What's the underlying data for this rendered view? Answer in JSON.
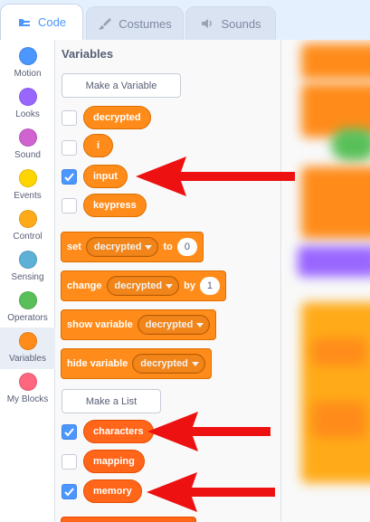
{
  "tabs": [
    {
      "label": "Code",
      "icon": "code-icon",
      "active": true
    },
    {
      "label": "Costumes",
      "icon": "paintbrush-icon",
      "active": false
    },
    {
      "label": "Sounds",
      "icon": "speaker-icon",
      "active": false
    }
  ],
  "categories": [
    {
      "label": "Motion",
      "color": "#4c97ff"
    },
    {
      "label": "Looks",
      "color": "#9966ff"
    },
    {
      "label": "Sound",
      "color": "#cf63cf"
    },
    {
      "label": "Events",
      "color": "#ffd500"
    },
    {
      "label": "Control",
      "color": "#ffab19"
    },
    {
      "label": "Sensing",
      "color": "#5cb1d6"
    },
    {
      "label": "Operators",
      "color": "#59c059"
    },
    {
      "label": "Variables",
      "color": "#ff8c1a",
      "selected": true
    },
    {
      "label": "My Blocks",
      "color": "#ff6680"
    }
  ],
  "palette": {
    "title": "Variables",
    "make_variable": "Make a Variable",
    "variables": [
      {
        "name": "decrypted",
        "checked": false
      },
      {
        "name": "i",
        "checked": false
      },
      {
        "name": "input",
        "checked": true
      },
      {
        "name": "keypress",
        "checked": false
      }
    ],
    "blocks": {
      "set": {
        "word": "set",
        "var": "decrypted",
        "to": "to",
        "value": "0"
      },
      "change": {
        "word": "change",
        "var": "decrypted",
        "by": "by",
        "value": "1"
      },
      "show": {
        "word": "show variable",
        "var": "decrypted"
      },
      "hide": {
        "word": "hide variable",
        "var": "decrypted"
      }
    },
    "make_list": "Make a List",
    "lists": [
      {
        "name": "characters",
        "checked": true
      },
      {
        "name": "mapping",
        "checked": false
      },
      {
        "name": "memory",
        "checked": true
      }
    ]
  },
  "annotations": {
    "arrow_color": "#ee1111"
  }
}
